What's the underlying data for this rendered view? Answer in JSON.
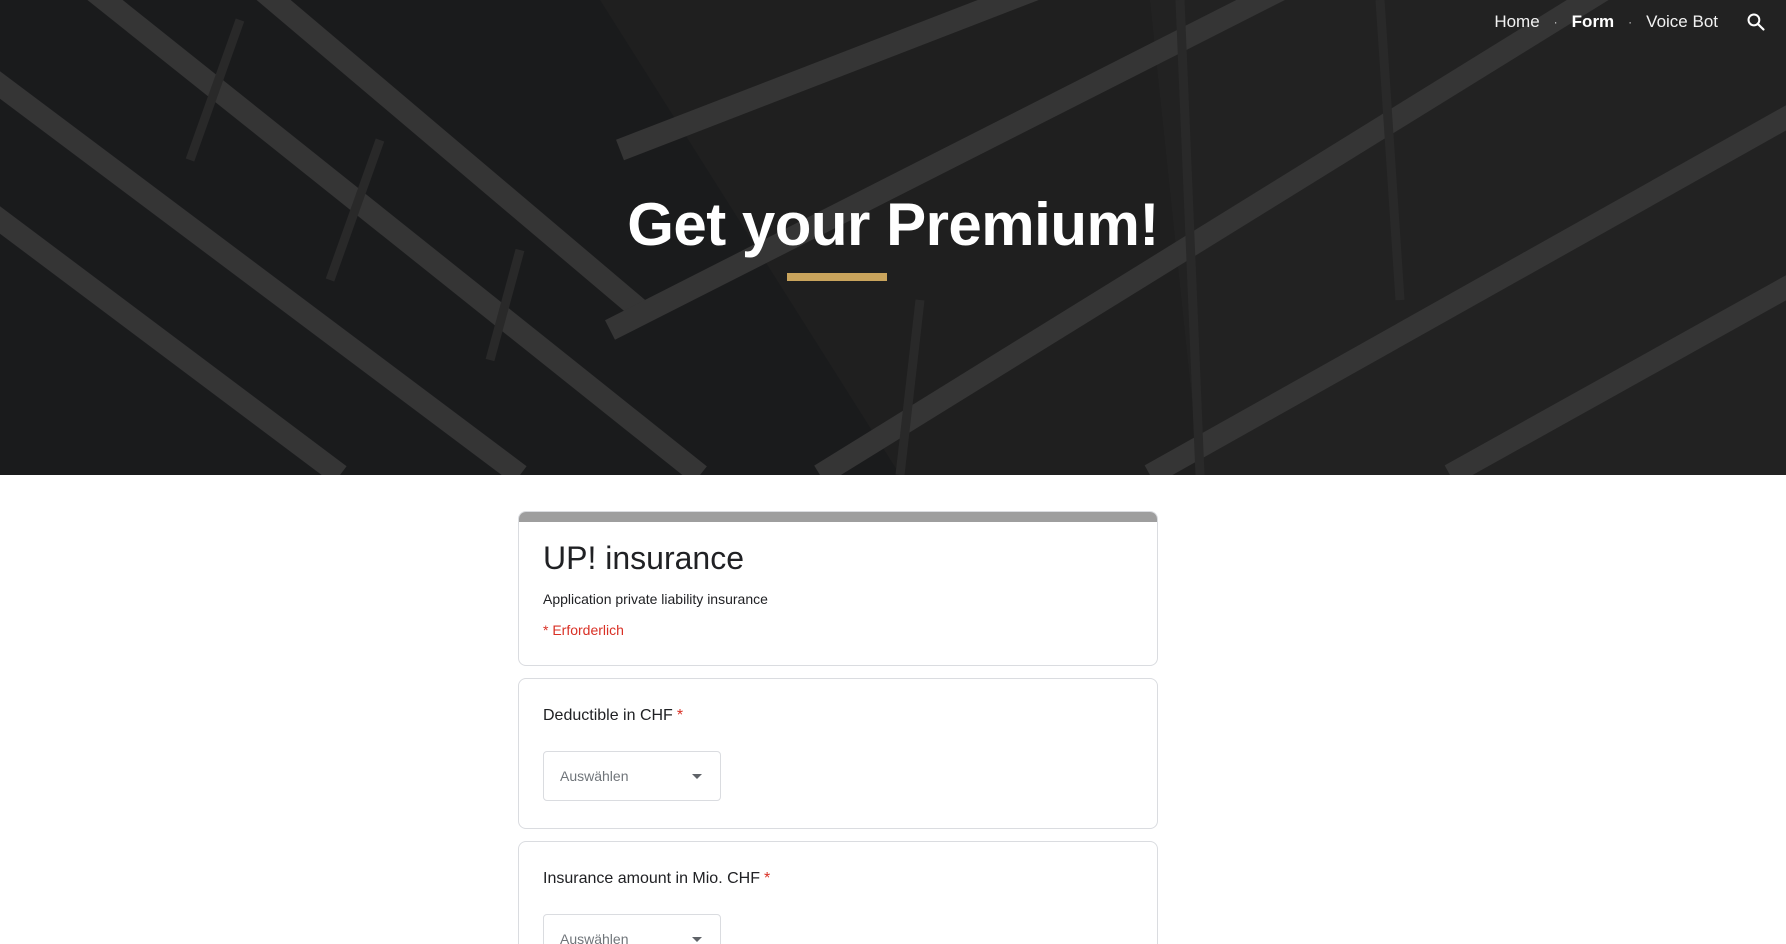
{
  "nav": {
    "items": [
      {
        "label": "Home",
        "active": false
      },
      {
        "label": "Form",
        "active": true
      },
      {
        "label": "Voice Bot",
        "active": false
      }
    ],
    "separator": "·",
    "search_icon": "search-icon"
  },
  "hero": {
    "title": "Get your Premium!",
    "accent_color": "#c9a45c"
  },
  "form": {
    "title": "UP! insurance",
    "description": "Application private liability insurance",
    "required_note": "* Erforderlich",
    "questions": [
      {
        "label": "Deductible in CHF",
        "required_mark": "*",
        "placeholder": "Auswählen"
      },
      {
        "label": "Insurance amount in Mio. CHF",
        "required_mark": "*",
        "placeholder": "Auswählen"
      }
    ]
  },
  "colors": {
    "required": "#d93025",
    "header_bar": "#9e9e9e",
    "border": "#dadce0"
  }
}
